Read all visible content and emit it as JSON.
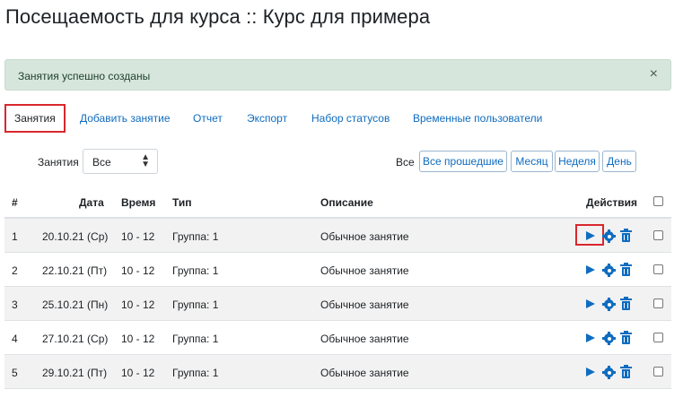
{
  "page": {
    "title": "Посещаемость для курса :: Курс для примера"
  },
  "alert": {
    "message": "Занятия успешно созданы",
    "close": "×"
  },
  "tabs": [
    {
      "label": "Занятия",
      "active": true
    },
    {
      "label": "Добавить занятие"
    },
    {
      "label": "Отчет"
    },
    {
      "label": "Экспорт"
    },
    {
      "label": "Набор статусов"
    },
    {
      "label": "Временные пользователи"
    }
  ],
  "filter": {
    "label": "Занятия",
    "selected": "Все"
  },
  "period": {
    "label": "Все",
    "buttons": [
      "Все прошедшие",
      "Месяц",
      "Неделя",
      "День"
    ]
  },
  "table": {
    "headers": {
      "num": "#",
      "date": "Дата",
      "time": "Время",
      "type": "Тип",
      "desc": "Описание",
      "actions": "Действия"
    },
    "rows": [
      {
        "num": "1",
        "date": "20.10.21 (Ср)",
        "time": "10 - 12",
        "type": "Группа: 1",
        "desc": "Обычное занятие"
      },
      {
        "num": "2",
        "date": "22.10.21 (Пт)",
        "time": "10 - 12",
        "type": "Группа: 1",
        "desc": "Обычное занятие"
      },
      {
        "num": "3",
        "date": "25.10.21 (Пн)",
        "time": "10 - 12",
        "type": "Группа: 1",
        "desc": "Обычное занятие"
      },
      {
        "num": "4",
        "date": "27.10.21 (Ср)",
        "time": "10 - 12",
        "type": "Группа: 1",
        "desc": "Обычное занятие"
      },
      {
        "num": "5",
        "date": "29.10.21 (Пт)",
        "time": "10 - 12",
        "type": "Группа: 1",
        "desc": "Обычное занятие"
      }
    ]
  },
  "colors": {
    "accent": "#0f6cbf",
    "highlight": "#d9272e",
    "alert_bg": "#d7e6dc"
  },
  "icons": [
    "play-icon",
    "gear-icon",
    "trash-icon",
    "close-icon",
    "chevron-updown-icon"
  ]
}
